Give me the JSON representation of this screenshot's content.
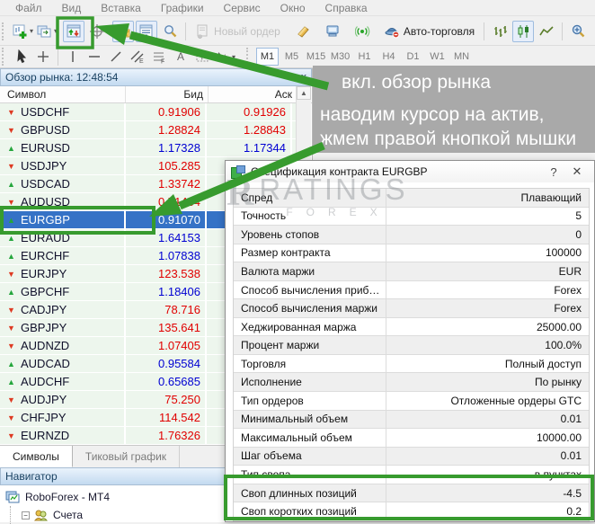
{
  "menu": {
    "items": [
      "Файл",
      "Вид",
      "Вставка",
      "Графики",
      "Сервис",
      "Окно",
      "Справка"
    ]
  },
  "toolbar": {
    "new_order_label": "Новый ордер",
    "autotrade_label": "Авто-торговля",
    "icons": [
      "new-chart-icon",
      "profiles-icon",
      "market-watch-icon",
      "crosshair-icon",
      "favorites-icon",
      "data-window-icon",
      "search-icon",
      "new-order-icon",
      "history-center-icon",
      "terminal-icon",
      "signals-icon",
      "autotrade-icon",
      "chart-bars-icon",
      "chart-candles-icon",
      "chart-line-icon",
      "zoom-in-icon"
    ],
    "drawing_tools": [
      "cursor-icon",
      "crosshair-tool-icon",
      "vertical-line-icon",
      "horizontal-line-icon",
      "trendline-icon",
      "equidistant-channel-icon",
      "fibonacci-icon",
      "text-icon",
      "text-label-icon",
      "arrows-icon"
    ]
  },
  "timeframes": {
    "items": [
      "M1",
      "M5",
      "M15",
      "M30",
      "H1",
      "H4",
      "D1",
      "W1",
      "MN"
    ],
    "active": "M1"
  },
  "market_watch": {
    "title": "Обзор рынка: 12:48:54",
    "close_glyph": "x",
    "columns": [
      "Символ",
      "Бид",
      "Аск"
    ],
    "rows": [
      {
        "symbol": "USDCHF",
        "dir": "down",
        "bid": "0.91906",
        "ask": "0.91926",
        "tone": "red",
        "selected": false
      },
      {
        "symbol": "GBPUSD",
        "dir": "down",
        "bid": "1.28824",
        "ask": "1.28843",
        "tone": "red",
        "selected": false
      },
      {
        "symbol": "EURUSD",
        "dir": "up",
        "bid": "1.17328",
        "ask": "1.17344",
        "tone": "blue",
        "selected": false
      },
      {
        "symbol": "USDJPY",
        "dir": "down",
        "bid": "105.285",
        "ask": "",
        "tone": "red",
        "selected": false
      },
      {
        "symbol": "USDCAD",
        "dir": "up",
        "bid": "1.33742",
        "ask": "",
        "tone": "red",
        "selected": false
      },
      {
        "symbol": "AUDUSD",
        "dir": "down",
        "bid": "0.71464",
        "ask": "",
        "tone": "red",
        "selected": false
      },
      {
        "symbol": "EURGBP",
        "dir": "up",
        "bid": "0.91070",
        "ask": "",
        "tone": "sel",
        "selected": true
      },
      {
        "symbol": "EURAUD",
        "dir": "up",
        "bid": "1.64153",
        "ask": "",
        "tone": "blue",
        "selected": false
      },
      {
        "symbol": "EURCHF",
        "dir": "up",
        "bid": "1.07838",
        "ask": "",
        "tone": "blue",
        "selected": false
      },
      {
        "symbol": "EURJPY",
        "dir": "down",
        "bid": "123.538",
        "ask": "",
        "tone": "red",
        "selected": false
      },
      {
        "symbol": "GBPCHF",
        "dir": "up",
        "bid": "1.18406",
        "ask": "",
        "tone": "blue",
        "selected": false
      },
      {
        "symbol": "CADJPY",
        "dir": "down",
        "bid": "78.716",
        "ask": "",
        "tone": "red",
        "selected": false
      },
      {
        "symbol": "GBPJPY",
        "dir": "down",
        "bid": "135.641",
        "ask": "",
        "tone": "red",
        "selected": false
      },
      {
        "symbol": "AUDNZD",
        "dir": "down",
        "bid": "1.07405",
        "ask": "",
        "tone": "red",
        "selected": false
      },
      {
        "symbol": "AUDCAD",
        "dir": "up",
        "bid": "0.95584",
        "ask": "",
        "tone": "blue",
        "selected": false
      },
      {
        "symbol": "AUDCHF",
        "dir": "up",
        "bid": "0.65685",
        "ask": "",
        "tone": "blue",
        "selected": false
      },
      {
        "symbol": "AUDJPY",
        "dir": "down",
        "bid": "75.250",
        "ask": "",
        "tone": "red",
        "selected": false
      },
      {
        "symbol": "CHFJPY",
        "dir": "down",
        "bid": "114.542",
        "ask": "",
        "tone": "red",
        "selected": false
      },
      {
        "symbol": "EURNZD",
        "dir": "down",
        "bid": "1.76326",
        "ask": "",
        "tone": "red",
        "selected": false
      }
    ],
    "tabs": [
      "Символы",
      "Тиковый график"
    ],
    "active_tab": "Символы"
  },
  "navigator": {
    "title": "Навигатор",
    "broker": "RoboForex - MT4",
    "accounts_item": "Счета"
  },
  "dialog": {
    "title": "Спецификация контракта EURGBP",
    "help_glyph": "?",
    "close_glyph": "✕",
    "rows": [
      {
        "label": "Спред",
        "value": "Плавающий"
      },
      {
        "label": "Точность",
        "value": "5"
      },
      {
        "label": "Уровень стопов",
        "value": "0"
      },
      {
        "label": "Размер контракта",
        "value": "100000"
      },
      {
        "label": "Валюта маржи",
        "value": "EUR"
      },
      {
        "label": "Способ вычисления приб…",
        "value": "Forex"
      },
      {
        "label": "Способ вычисления маржи",
        "value": "Forex"
      },
      {
        "label": "Хеджированная маржа",
        "value": "25000.00"
      },
      {
        "label": "Процент маржи",
        "value": "100.0%"
      },
      {
        "label": "Торговля",
        "value": "Полный доступ"
      },
      {
        "label": "Исполнение",
        "value": "По рынку"
      },
      {
        "label": "Тип ордеров",
        "value": "Отложенные ордеры GTC"
      },
      {
        "label": "Минимальный объем",
        "value": "0.01"
      },
      {
        "label": "Максимальный объем",
        "value": "10000.00"
      },
      {
        "label": "Шаг объема",
        "value": "0.01"
      },
      {
        "label": "Тип свопа",
        "value": "в пунктах"
      },
      {
        "label": "Своп длинных позиций",
        "value": "-4.5"
      },
      {
        "label": "Своп коротких позиций",
        "value": "0.2"
      }
    ]
  },
  "annotations": {
    "line1": "вкл. обзор рынка",
    "line2": "наводим курсор на актив,",
    "line3": "жмем правой кнопкой мышки"
  },
  "watermark": {
    "brand": "RATINGS",
    "sub": "FOREX",
    "logo": "R"
  },
  "colors": {
    "annotation_green": "#379b2e",
    "annotation_gray": "#a9a9a9",
    "selection_blue": "#3572c6",
    "bid_red": "#e10000",
    "bid_blue": "#0000d2",
    "row_green_bg": "#edf6ed"
  }
}
